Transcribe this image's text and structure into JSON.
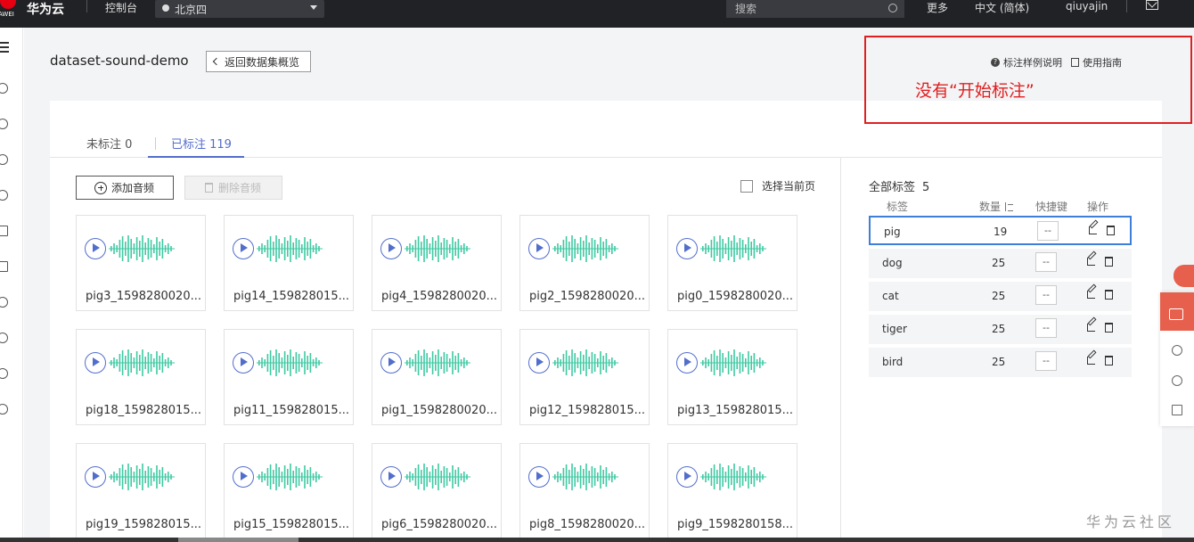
{
  "topbar": {
    "logo_text": "AWEI",
    "brand": "华为云",
    "console": "控制台",
    "region": "北京四",
    "search_placeholder": "搜索",
    "more": "更多",
    "language": "中文 (简体)",
    "user": "qiuyajin"
  },
  "header": {
    "title": "dataset-sound-demo",
    "back_button": "返回数据集概览",
    "help_example": "标注样例说明",
    "help_guide": "使用指南"
  },
  "annotation": {
    "text": "没有“开始标注”",
    "color": "#e02020"
  },
  "tabs": [
    {
      "label": "未标注 0",
      "active": false
    },
    {
      "label": "已标注 119",
      "active": true
    }
  ],
  "toolbar": {
    "add_audio": "添加音频",
    "delete_audio": "删除音频",
    "select_page": "选择当前页"
  },
  "files": [
    "pig3_1598280020...",
    "pig14_159828015...",
    "pig4_1598280020...",
    "pig2_1598280020...",
    "pig0_1598280020...",
    "pig18_159828015...",
    "pig11_159828015...",
    "pig1_1598280020...",
    "pig12_159828015...",
    "pig13_159828015...",
    "pig19_159828015...",
    "pig15_159828015...",
    "pig6_1598280020...",
    "pig8_1598280020...",
    "pig9_1598280158..."
  ],
  "labels_panel": {
    "title": "全部标签",
    "count": "5",
    "columns": {
      "label": "标签",
      "count": "数量",
      "hotkey": "快捷键",
      "action": "操作"
    },
    "rows": [
      {
        "name": "pig",
        "count": "19",
        "hotkey": "--",
        "selected": true
      },
      {
        "name": "dog",
        "count": "25",
        "hotkey": "--",
        "selected": false
      },
      {
        "name": "cat",
        "count": "25",
        "hotkey": "--",
        "selected": false
      },
      {
        "name": "tiger",
        "count": "25",
        "hotkey": "--",
        "selected": false
      },
      {
        "name": "bird",
        "count": "25",
        "hotkey": "--",
        "selected": false
      }
    ]
  },
  "watermark": "华为云社区",
  "colors": {
    "accent": "#526ecc",
    "wave": "#3fc9a3",
    "topbar": "#212226",
    "selected_border": "#3d7fd9"
  }
}
